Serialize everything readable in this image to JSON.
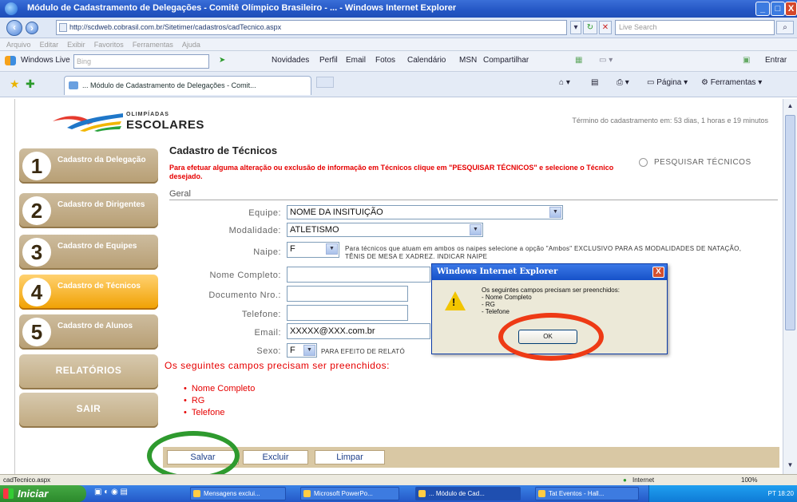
{
  "window": {
    "title": "Módulo de Cadastramento de Delegações - Comitê Olímpico Brasileiro - ... - Windows Internet Explorer",
    "min": "_",
    "max": "□",
    "close": "X"
  },
  "address": {
    "url": "http://scdweb.cobrasil.com.br/Sitetimer/cadastros/cadTecnico.aspx",
    "search_placeholder": "Live Search"
  },
  "menu": [
    "Arquivo",
    "Editar",
    "Exibir",
    "Favoritos",
    "Ferramentas",
    "Ajuda"
  ],
  "links": {
    "windows_live": "Windows Live",
    "search": "Bing",
    "items": [
      "Novidades",
      "Perfil",
      "Email",
      "Fotos",
      "Calendário",
      "MSN",
      "Compartilhar"
    ],
    "signin": "Entrar"
  },
  "tab": {
    "label": "... Módulo de Cadastramento de Delegações - Comit...",
    "tools": [
      "Página",
      "Ferramentas"
    ]
  },
  "logo": {
    "line1": "OLIMPÍADAS",
    "line2": "ESCOLARES"
  },
  "remaining": "Término do cadastramento em: 53 dias, 1 horas e 19 minutos",
  "sidebar": [
    {
      "num": "1",
      "label": "Cadastro da Delegação",
      "active": false
    },
    {
      "num": "2",
      "label": "Cadastro de Dirigentes",
      "active": false
    },
    {
      "num": "3",
      "label": "Cadastro de Equipes",
      "active": false
    },
    {
      "num": "4",
      "label": "Cadastro de Técnicos",
      "active": true
    },
    {
      "num": "5",
      "label": "Cadastro de Alunos",
      "active": false
    },
    {
      "num": "",
      "label": "RELATÓRIOS",
      "active": false
    },
    {
      "num": "",
      "label": "SAIR",
      "active": false
    }
  ],
  "content": {
    "title": "Cadastro de Técnicos",
    "warning": "Para efetuar alguma alteração ou exclusão de informação em Técnicos clique em \"PESQUISAR TÉCNICOS\" e selecione o Técnico desejado.",
    "search_link": "PESQUISAR TÉCNICOS",
    "section": "Geral"
  },
  "form": {
    "equipe_label": "Equipe:",
    "equipe_value": "NOME DA INSITUIÇÃO",
    "modalidade_label": "Modalidade:",
    "modalidade_value": "ATLETISMO",
    "naipe_label": "Naipe:",
    "naipe_value": "F",
    "naipe_note": "Para técnicos que atuam em ambos os naipes selecione a opção \"Ambos\" EXCLUSIVO PARA AS MODALIDADES DE NATAÇÃO, TÊNIS DE MESA E XADREZ. INDICAR NAIPE",
    "nome_label": "Nome Completo:",
    "documento_label": "Documento Nro.:",
    "telefone_label": "Telefone:",
    "email_label": "Email:",
    "email_value": "XXXXX@XXX.com.br",
    "sexo_label": "Sexo:",
    "sexo_value": "F",
    "sexo_note": "PARA EFEITO DE RELATÓ"
  },
  "errors": {
    "heading": "Os seguintes campos precisam ser preenchidos:",
    "items": [
      "Nome Completo",
      "RG",
      "Telefone"
    ]
  },
  "buttons": {
    "save": "Salvar",
    "delete": "Excluir",
    "clear": "Limpar"
  },
  "dialog": {
    "title": "Windows Internet Explorer",
    "close": "X",
    "message_head": "Os seguintes campos precisam ser preenchidos:",
    "message_items": [
      "- Nome Completo",
      "- RG",
      "- Telefone"
    ],
    "ok": "OK"
  },
  "status": {
    "left": "cadTecnico.aspx",
    "zone": "Internet",
    "zoom": "100%"
  },
  "taskbar": {
    "start": "Iniciar",
    "items": [
      "Mensagens exclui...",
      "Microsoft PowerPo...",
      "... Módulo de Cad...",
      "Tat Eventos - Hall..."
    ],
    "tray": "PT  18:20"
  }
}
